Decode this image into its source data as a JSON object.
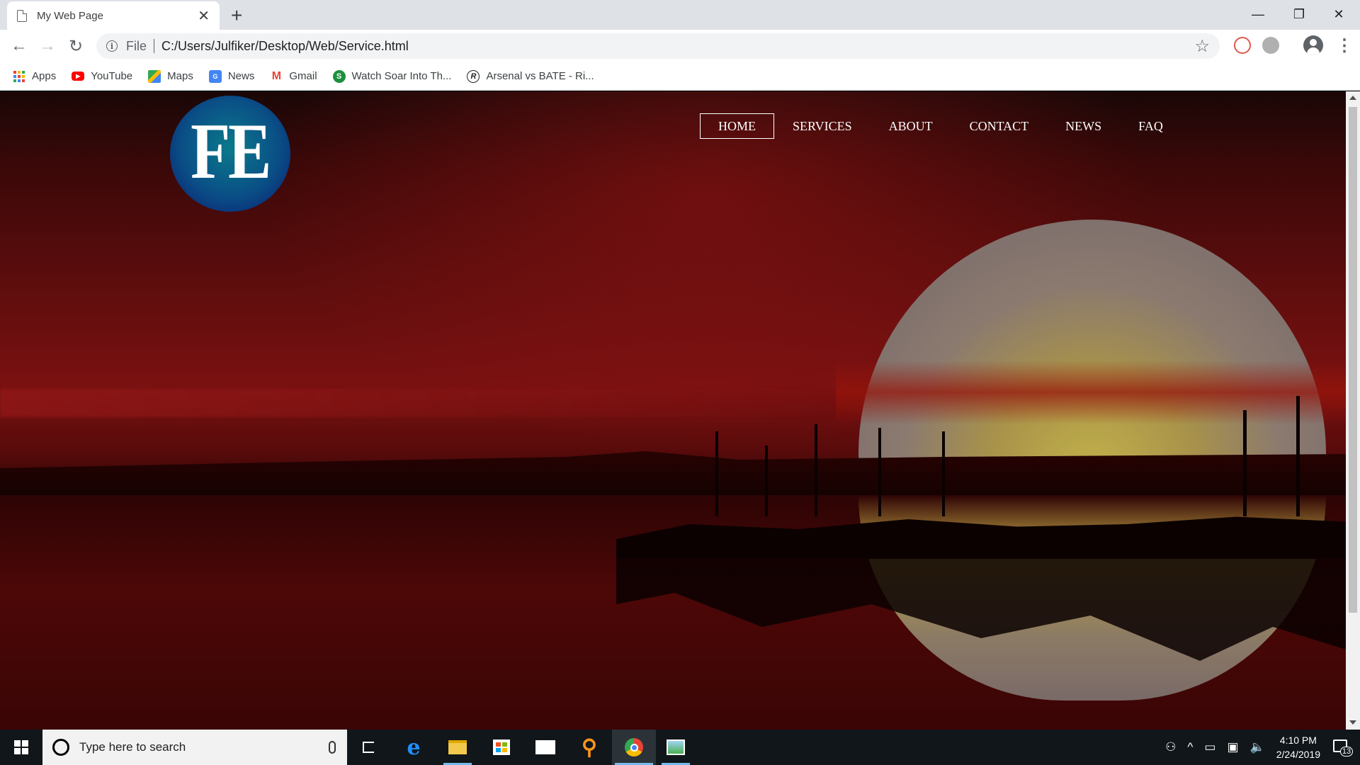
{
  "browser": {
    "tab_title": "My Web Page",
    "url_scheme": "File",
    "url": "C:/Users/Julfiker/Desktop/Web/Service.html",
    "bookmarks": [
      {
        "label": "Apps",
        "icon": "apps-grid-icon"
      },
      {
        "label": "YouTube",
        "icon": "youtube-icon"
      },
      {
        "label": "Maps",
        "icon": "maps-icon"
      },
      {
        "label": "News",
        "icon": "news-icon"
      },
      {
        "label": "Gmail",
        "icon": "gmail-icon"
      },
      {
        "label": "Watch Soar Into Th...",
        "icon": "green-s-icon"
      },
      {
        "label": "Arsenal vs BATE - Ri...",
        "icon": "r-logo-icon"
      }
    ]
  },
  "site": {
    "logo_text": "FE",
    "nav": [
      {
        "label": "HOME",
        "active": true
      },
      {
        "label": "SERVICES",
        "active": false
      },
      {
        "label": "ABOUT",
        "active": false
      },
      {
        "label": "CONTACT",
        "active": false
      },
      {
        "label": "NEWS",
        "active": false
      },
      {
        "label": "FAQ",
        "active": false
      }
    ]
  },
  "taskbar": {
    "search_placeholder": "Type here to search",
    "apps": [
      "task-view-icon",
      "edge-icon",
      "file-explorer-icon",
      "store-icon",
      "mail-icon",
      "search-app-icon",
      "chrome-icon",
      "image-viewer-icon"
    ],
    "time": "4:10 PM",
    "date": "2/24/2019",
    "notification_count": "13"
  },
  "colors": {
    "accent": "#76b9ed",
    "sky_red": "#7a1111",
    "sun": "#b79f43"
  }
}
